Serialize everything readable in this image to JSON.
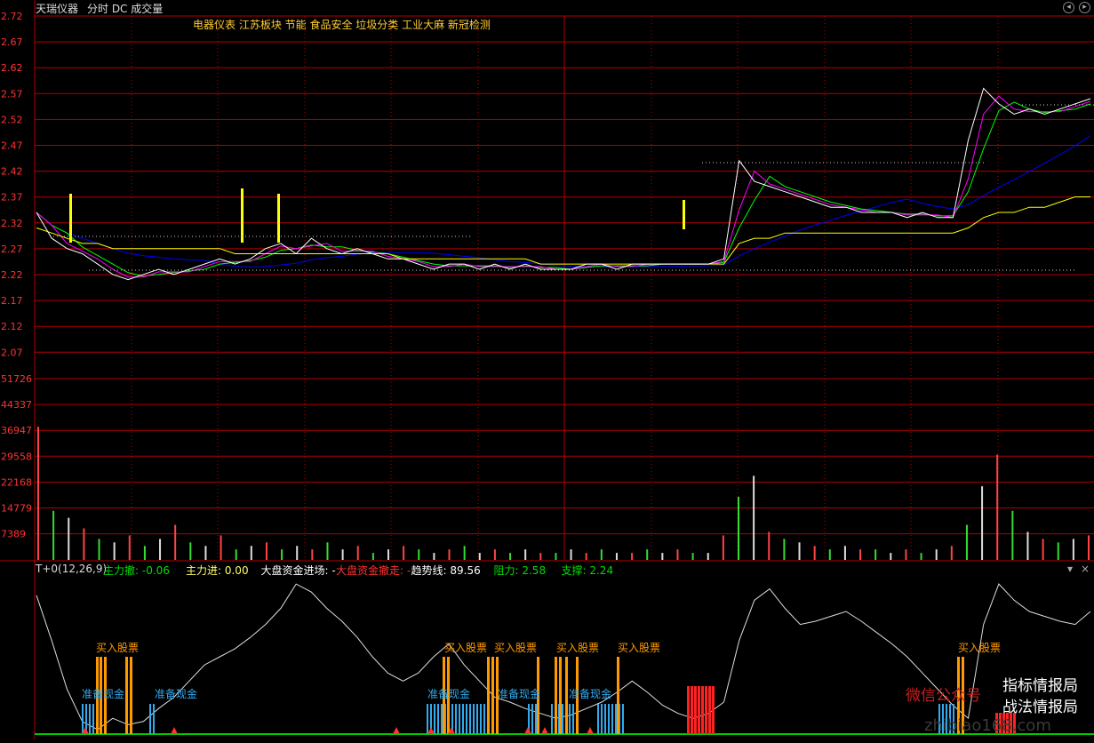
{
  "header": {
    "stock_name": "天瑞仪器",
    "mode": "分时 DC 成交量",
    "concepts": "电器仪表 江苏板块 节能 食品安全 垃圾分类 工业大麻 新冠检测"
  },
  "price_axis": [
    "2.72",
    "2.67",
    "2.62",
    "2.57",
    "2.52",
    "2.47",
    "2.42",
    "2.37",
    "2.32",
    "2.27",
    "2.22",
    "2.17",
    "2.12",
    "2.07"
  ],
  "volume_axis": [
    "51726",
    "44337",
    "36947",
    "29558",
    "22168",
    "14779",
    "7389"
  ],
  "indicator": {
    "params": "T+0(12,26,9)",
    "items": [
      {
        "label": "主力撤: -0.06",
        "color": "#00dd00"
      },
      {
        "label": "主力进: 0.00",
        "color": "#ffff66"
      },
      {
        "label": "大盘资金进场: -",
        "color": "#ffffff"
      },
      {
        "label": "大盘资金撤走: -",
        "color": "#ff3333"
      },
      {
        "label": "趋势线: 89.56",
        "color": "#ffffff"
      },
      {
        "label": "阻力: 2.58",
        "color": "#00dd00"
      },
      {
        "label": "支撑: 2.24",
        "color": "#00dd00"
      }
    ]
  },
  "signals": {
    "buy": [
      "买入股票",
      "买入股票",
      "买入股票",
      "买入股票",
      "买入股票",
      "买入股票"
    ],
    "prepare": [
      "准备现金",
      "准备现金",
      "准备现金",
      "准备现金",
      "准备现金"
    ]
  },
  "watermark": {
    "wechat": "微信公众号",
    "line1": "指标情报局",
    "line2": "战法情报局",
    "site": "zhibiao168.com"
  },
  "colors": {
    "bg": "#000000",
    "grid": "#b30000",
    "price": "#ffffff",
    "avg": "#ffff00",
    "ma1": "#00ff00",
    "ma2": "#ff00ff",
    "ma3": "#0000ff",
    "buy": "#ff9900",
    "prepare": "#33aaee",
    "big": "#ff2222"
  },
  "chart_data": [
    {
      "type": "line",
      "title": "分时",
      "ylim": [
        2.07,
        2.72
      ],
      "series": [
        {
          "name": "price",
          "values": [
            2.34,
            2.29,
            2.27,
            2.26,
            2.24,
            2.22,
            2.21,
            2.22,
            2.23,
            2.22,
            2.23,
            2.24,
            2.25,
            2.24,
            2.25,
            2.27,
            2.28,
            2.26,
            2.29,
            2.27,
            2.26,
            2.27,
            2.26,
            2.25,
            2.25,
            2.24,
            2.23,
            2.24,
            2.24,
            2.23,
            2.24,
            2.23,
            2.24,
            2.23,
            2.23,
            2.23,
            2.24,
            2.24,
            2.23,
            2.24,
            2.24,
            2.24,
            2.24,
            2.24,
            2.24,
            2.25,
            2.44,
            2.4,
            2.39,
            2.38,
            2.37,
            2.36,
            2.35,
            2.35,
            2.34,
            2.34,
            2.34,
            2.33,
            2.34,
            2.33,
            2.33,
            2.48,
            2.58,
            2.55,
            2.53,
            2.54,
            2.53,
            2.54,
            2.55,
            2.56
          ]
        },
        {
          "name": "avg",
          "values": [
            2.31,
            2.3,
            2.29,
            2.28,
            2.28,
            2.27,
            2.27,
            2.27,
            2.27,
            2.27,
            2.27,
            2.27,
            2.27,
            2.26,
            2.26,
            2.26,
            2.26,
            2.26,
            2.26,
            2.26,
            2.26,
            2.26,
            2.26,
            2.26,
            2.25,
            2.25,
            2.25,
            2.25,
            2.25,
            2.25,
            2.25,
            2.25,
            2.25,
            2.24,
            2.24,
            2.24,
            2.24,
            2.24,
            2.24,
            2.24,
            2.24,
            2.24,
            2.24,
            2.24,
            2.24,
            2.24,
            2.28,
            2.29,
            2.29,
            2.3,
            2.3,
            2.3,
            2.3,
            2.3,
            2.3,
            2.3,
            2.3,
            2.3,
            2.3,
            2.3,
            2.3,
            2.31,
            2.33,
            2.34,
            2.34,
            2.35,
            2.35,
            2.36,
            2.37,
            2.37
          ]
        }
      ]
    },
    {
      "type": "bar",
      "title": "成交量",
      "ylim": [
        0,
        51726
      ],
      "values": [
        38000,
        14000,
        12000,
        9000,
        6000,
        5000,
        7000,
        4000,
        6000,
        10000,
        5000,
        4000,
        7000,
        3000,
        4000,
        5000,
        3000,
        4000,
        3000,
        5000,
        3000,
        4000,
        2000,
        3000,
        4000,
        3000,
        2000,
        3000,
        4000,
        2000,
        3000,
        2000,
        3000,
        2000,
        2000,
        3000,
        2000,
        3000,
        2000,
        2000,
        3000,
        2000,
        3000,
        2000,
        2000,
        7000,
        18000,
        24000,
        8000,
        6000,
        5000,
        4000,
        3000,
        4000,
        3000,
        3000,
        2000,
        3000,
        2000,
        3000,
        4000,
        10000,
        21000,
        30000,
        14000,
        8000,
        6000,
        5000,
        6000,
        7000
      ]
    },
    {
      "type": "line",
      "title": "T+0(12,26,9)",
      "ylim": [
        0,
        100
      ],
      "series": [
        {
          "name": "趋势线",
          "values": [
            88,
            60,
            30,
            10,
            5,
            12,
            8,
            10,
            18,
            25,
            35,
            45,
            50,
            55,
            62,
            70,
            80,
            95,
            90,
            80,
            72,
            62,
            50,
            40,
            35,
            40,
            50,
            58,
            45,
            35,
            25,
            22,
            18,
            15,
            12,
            14,
            18,
            22,
            28,
            35,
            28,
            20,
            15,
            12,
            15,
            22,
            60,
            85,
            92,
            80,
            70,
            72,
            75,
            78,
            72,
            65,
            58,
            50,
            40,
            30,
            20,
            12,
            70,
            95,
            85,
            78,
            75,
            72,
            70,
            78
          ]
        }
      ]
    }
  ]
}
